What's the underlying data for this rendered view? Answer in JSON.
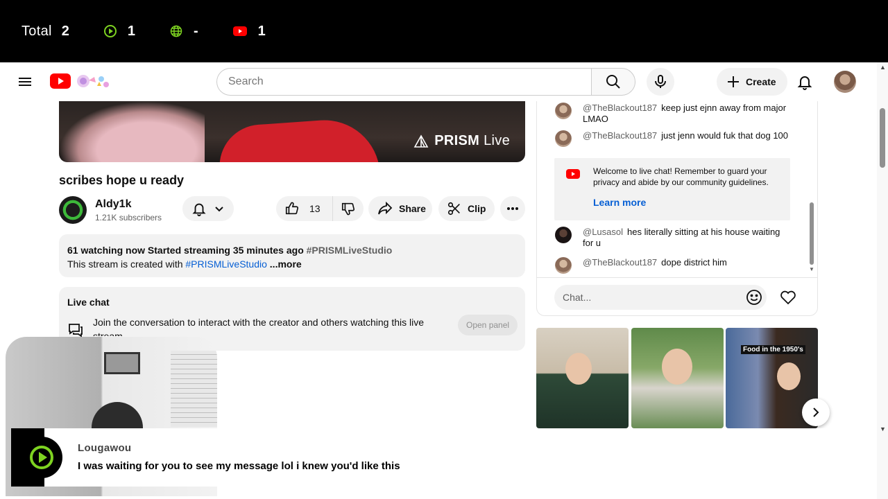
{
  "overlay": {
    "total_label": "Total",
    "total_value": "2",
    "play_value": "1",
    "globe_value": "-",
    "youtube_value": "1",
    "colors": {
      "play": "#7ed321",
      "globe": "#7ed321",
      "youtube": "#ff0000"
    }
  },
  "header": {
    "search_placeholder": "Search",
    "create_label": "Create"
  },
  "video": {
    "watermark_brand": "PRISM",
    "watermark_live": "Live",
    "title": "scribes hope u ready"
  },
  "channel": {
    "name": "Aldy1k",
    "subscribers": "1.21K subscribers"
  },
  "actions": {
    "like_count": "13",
    "share_label": "Share",
    "clip_label": "Clip"
  },
  "description": {
    "watching": "61 watching now",
    "started": "Started streaming 35 minutes ago",
    "hashtag": "#PRISMLiveStudio",
    "line2_prefix": "This stream is created with ",
    "line2_link": "#PRISMLiveStudio",
    "more_label": " ...more"
  },
  "livechat_card": {
    "title": "Live chat",
    "text": "Join the conversation to interact with the creator and others watching this live stream",
    "open_label": "Open panel"
  },
  "chat": {
    "messages": [
      {
        "author": "@TheBlackout187",
        "text": "keep just ejnn away from major LMAO"
      },
      {
        "author": "@TheBlackout187",
        "text": "just jenn would fuk that dog 100"
      },
      {
        "author": "@Lusasol",
        "text": "hes literally sitting at his house waiting for u"
      },
      {
        "author": "@TheBlackout187",
        "text": "dope district him"
      }
    ],
    "banner_text": "Welcome to live chat! Remember to guard your privacy and abide by our community guidelines.",
    "banner_link": "Learn more",
    "input_placeholder": "Chat..."
  },
  "thumbnails": {
    "caption3": "Food in the 1950's"
  },
  "notification": {
    "user": "Lougawou",
    "message": "I was waiting for you to see my message lol i knew you'd like this"
  }
}
